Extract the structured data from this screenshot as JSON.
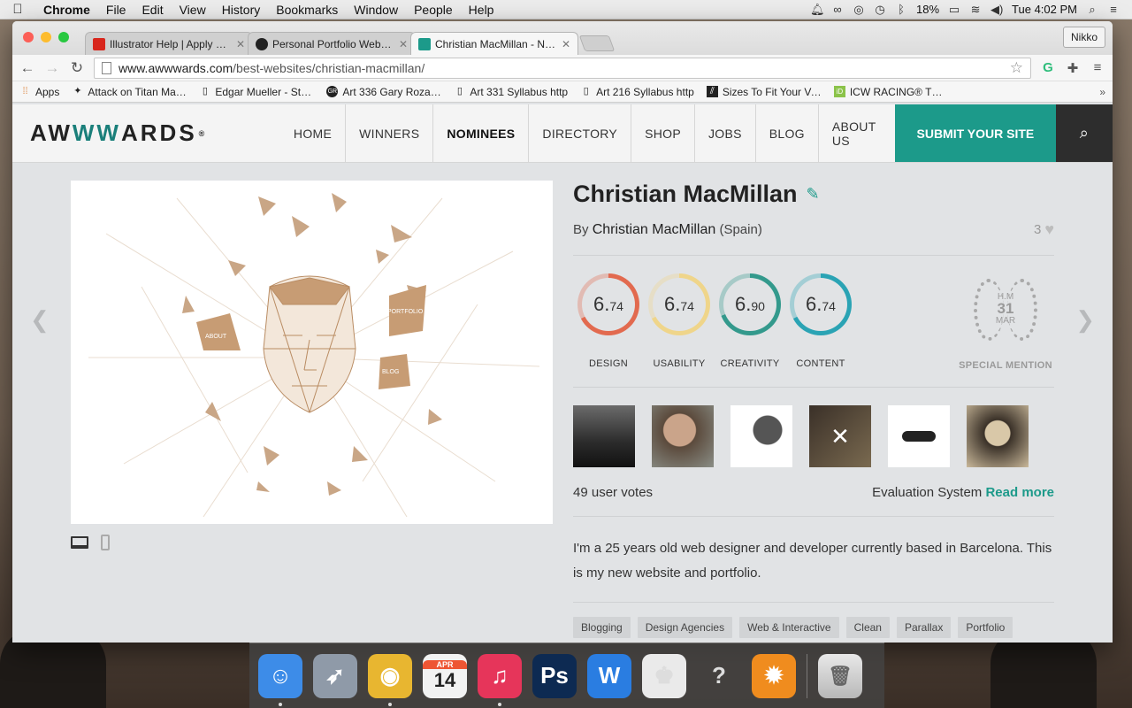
{
  "menubar": {
    "app": "Chrome",
    "menus": [
      "File",
      "Edit",
      "View",
      "History",
      "Bookmarks",
      "Window",
      "People",
      "Help"
    ],
    "battery": "18%",
    "clock": "Tue 4:02 PM"
  },
  "browser": {
    "profile": "Nikko",
    "tabs": [
      {
        "label": "Illustrator Help | Apply or e...",
        "favicon_color": "#d8261c"
      },
      {
        "label": "Personal Portfolio Website",
        "favicon_color": "#222222"
      },
      {
        "label": "Christian MacMillan - Nomi...",
        "favicon_color": "#1c9a8a"
      }
    ],
    "url_host": "www.awwwards.com",
    "url_path": "/best-websites/christian-macmillan/",
    "bookmarks": [
      {
        "label": "Apps",
        "icon": "apps-grid-icon"
      },
      {
        "label": "Attack on Titan Manga",
        "icon": "manga-icon"
      },
      {
        "label": "Edgar Mueller - Street",
        "icon": "page-icon"
      },
      {
        "label": "Art 336 Gary Rozanc",
        "icon": "gr-icon"
      },
      {
        "label": "Art 331 Syllabus http",
        "icon": "page-icon"
      },
      {
        "label": "Art 216 Syllabus http",
        "icon": "page-icon"
      },
      {
        "label": "Sizes To Fit Your Veh",
        "icon": "stripe-icon"
      },
      {
        "label": "ICW RACING® TSUN",
        "icon": "id-icon"
      }
    ]
  },
  "site": {
    "logo_a": "AW",
    "logo_ww": "WW",
    "logo_b": "ARDS",
    "logo_reg": "®",
    "nav": [
      "HOME",
      "WINNERS",
      "NOMINEES",
      "DIRECTORY",
      "SHOP",
      "JOBS",
      "BLOG",
      "ABOUT US"
    ],
    "nav_active": "NOMINEES",
    "submit": "SUBMIT YOUR SITE",
    "title": "Christian MacMillan",
    "by": "By",
    "author": "Christian MacMillan",
    "country": "(Spain)",
    "likes": "3",
    "scores": [
      {
        "label": "DESIGN",
        "int": "6.",
        "dec": "74",
        "value": 6.74,
        "color": "#e26a4f"
      },
      {
        "label": "USABILITY",
        "int": "6.",
        "dec": "74",
        "value": 6.74,
        "color": "#efd58a"
      },
      {
        "label": "CREATIVITY",
        "int": "6.",
        "dec": "90",
        "value": 6.9,
        "color": "#33998c"
      },
      {
        "label": "CONTENT",
        "int": "6.",
        "dec": "74",
        "value": 6.74,
        "color": "#2aa3b4"
      }
    ],
    "mention": {
      "hm": "H.M",
      "day": "31",
      "month": "MAR",
      "label": "SPECIAL MENTION"
    },
    "votes": "49 user votes",
    "eval_text": "Evaluation System",
    "read_more": "Read more",
    "description": "I'm a 25 years old web designer and developer currently based in Barcelona. This is my new website and portfolio.",
    "shot_labels": [
      "ABOUT",
      "PORTFOLIO",
      "BLOG"
    ],
    "tags": [
      "Blogging",
      "Design Agencies",
      "Web & Interactive",
      "Clean",
      "Parallax",
      "Portfolio"
    ]
  },
  "dock": [
    {
      "name": "finder-icon",
      "glyph": "☺",
      "bg": "#3d8ce8",
      "running": true
    },
    {
      "name": "launchpad-icon",
      "glyph": "➶",
      "bg": "#8f9aa8",
      "running": false
    },
    {
      "name": "chrome-icon",
      "glyph": "◉",
      "bg": "#e8b630",
      "running": true
    },
    {
      "name": "calendar-icon",
      "glyph": "14",
      "bg": "#f2f2f2",
      "running": false
    },
    {
      "name": "itunes-icon",
      "glyph": "♫",
      "bg": "#e6355a",
      "running": true
    },
    {
      "name": "photoshop-icon",
      "glyph": "Ps",
      "bg": "#0d2a52",
      "running": false
    },
    {
      "name": "word-icon",
      "glyph": "W",
      "bg": "#2a7de1",
      "running": false
    },
    {
      "name": "mic-app-icon",
      "glyph": "♚",
      "bg": "#eaeaea",
      "running": false
    },
    {
      "name": "unknown-app-icon",
      "glyph": "?",
      "bg": "transparent",
      "running": false
    },
    {
      "name": "avast-icon",
      "glyph": "✹",
      "bg": "#f08c1e",
      "running": false
    }
  ],
  "calendar_month": "APR"
}
